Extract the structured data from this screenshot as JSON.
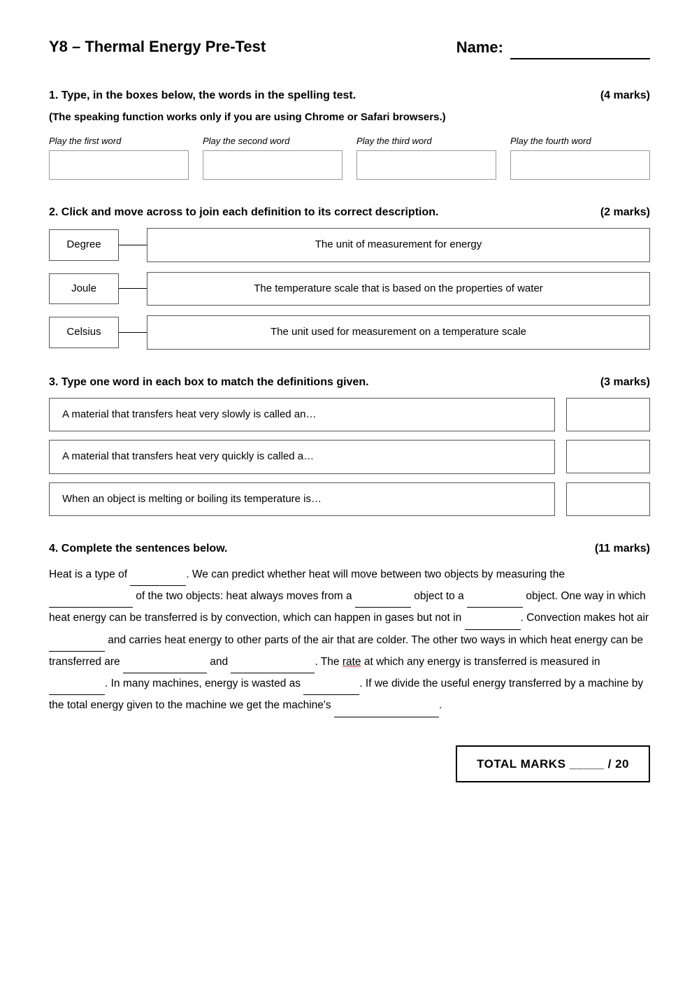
{
  "header": {
    "title": "Y8 – Thermal Energy Pre-Test",
    "name_label": "Name:",
    "name_underline": ""
  },
  "q1": {
    "number": "1.",
    "instruction": "Type, in the boxes below, the words in the spelling test.",
    "marks": "(4 marks)",
    "subtitle": "(The speaking function works only if you are using Chrome or Safari browsers.)",
    "words": [
      {
        "label": "Play the first word",
        "placeholder": ""
      },
      {
        "label": "Play the second word",
        "placeholder": ""
      },
      {
        "label": "Play the third word",
        "placeholder": ""
      },
      {
        "label": "Play the fourth word",
        "placeholder": ""
      }
    ]
  },
  "q2": {
    "number": "2.",
    "instruction": "Click and move across to join each definition to its correct description.",
    "marks": "(2 marks)",
    "rows": [
      {
        "term": "Degree",
        "definition": "The unit of measurement for energy"
      },
      {
        "term": "Joule",
        "definition": "The temperature scale that is based on the properties of water"
      },
      {
        "term": "Celsius",
        "definition": "The unit used for measurement on a temperature scale"
      }
    ]
  },
  "q3": {
    "number": "3.",
    "instruction": "Type one word in each box to match the definitions given.",
    "marks": "(3 marks)",
    "rows": [
      {
        "prompt": "A material that transfers heat very slowly is called an…"
      },
      {
        "prompt": "A material that transfers heat very quickly is called a…"
      },
      {
        "prompt": "When an object is melting or boiling its temperature is…"
      }
    ]
  },
  "q4": {
    "number": "4.",
    "instruction": "Complete the sentences below.",
    "marks": "(11 marks)",
    "sentences": [
      "Heat is a type of ________. We can predict whether heat will move between two objects by measuring the ____________ of the two objects: heat always moves from a ________ object to a _________ object. One way in which heat energy can be transferred is by convection, which can happen in gases but not in _________. Convection makes hot air _________ and carries heat energy to other parts of the air that are colder. The other two ways in which heat energy can be transferred are ___________ and ___________. The rate at which any energy is transferred is measured in _________. In many machines, energy is wasted as _________. If we divide the useful energy transferred by a machine by the total energy given to the machine we get the machine's ____________."
    ]
  },
  "total": {
    "label": "TOTAL MARKS _____ / 20"
  }
}
